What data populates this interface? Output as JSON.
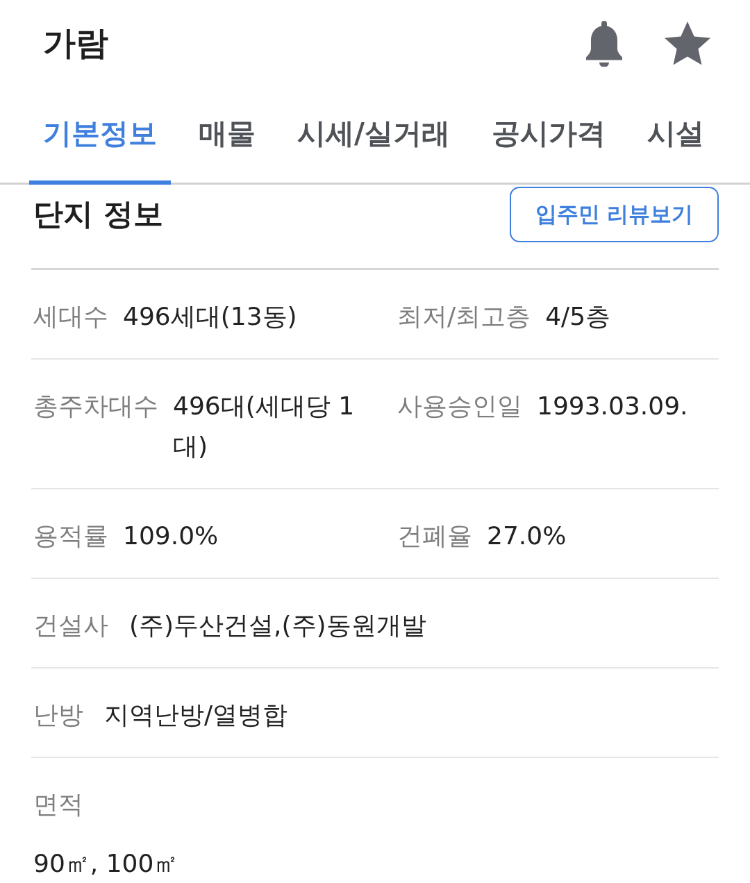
{
  "header": {
    "title": "가람"
  },
  "tabs": [
    {
      "label": "기본정보",
      "selected": true
    },
    {
      "label": "매물",
      "selected": false
    },
    {
      "label": "시세/실거래",
      "selected": false
    },
    {
      "label": "공시가격",
      "selected": false
    },
    {
      "label": "시설",
      "selected": false
    }
  ],
  "section": {
    "title": "단지 정보",
    "review_button": "입주민 리뷰보기"
  },
  "info_rows": [
    {
      "kind": "pair",
      "items": [
        {
          "label": "세대수",
          "value": "496세대(13동)"
        },
        {
          "label": "최저/최고층",
          "value": "4/5층"
        }
      ]
    },
    {
      "kind": "pair",
      "items": [
        {
          "label": "총주차대수",
          "value": "496대(세대당 1대)"
        },
        {
          "label": "사용승인일",
          "value": "1993.03.09."
        }
      ]
    },
    {
      "kind": "pair",
      "items": [
        {
          "label": "용적률",
          "value": "109.0%"
        },
        {
          "label": "건폐율",
          "value": "27.0%"
        }
      ]
    },
    {
      "kind": "single",
      "items": [
        {
          "label": "건설사",
          "value": "(주)두산건설,(주)동원개발"
        }
      ]
    },
    {
      "kind": "single",
      "items": [
        {
          "label": "난방",
          "value": "지역난방/열병합"
        }
      ]
    },
    {
      "kind": "stacked",
      "items": [
        {
          "label": "면적",
          "value": "90㎡, 100㎡"
        }
      ]
    }
  ]
}
